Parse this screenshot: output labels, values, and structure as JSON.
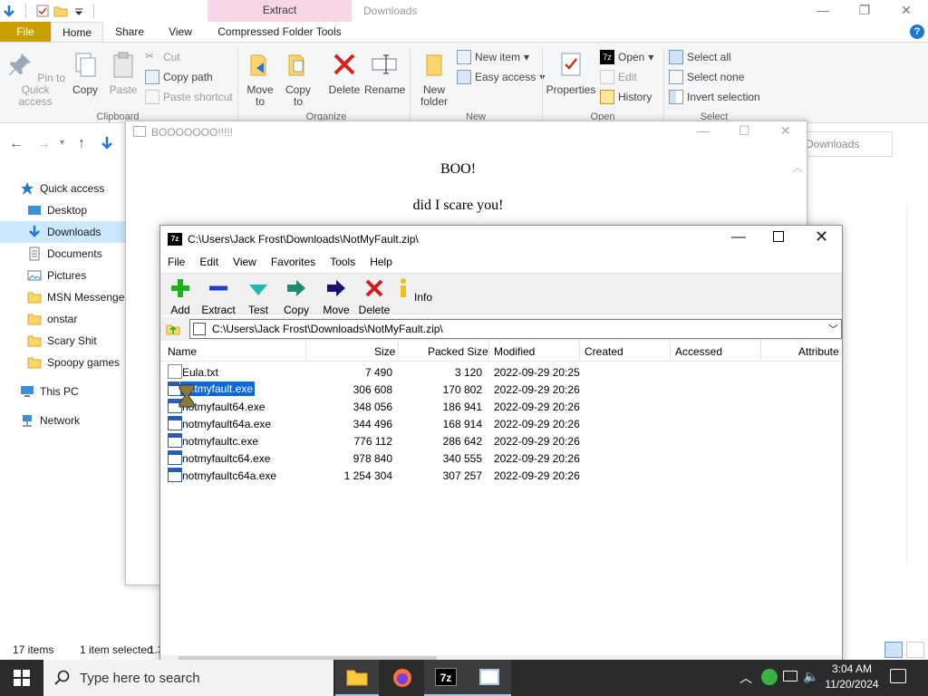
{
  "explorer": {
    "context_tab": "Extract",
    "window_title": "Downloads",
    "tabs": [
      "File",
      "Home",
      "Share",
      "View",
      "Compressed Folder Tools"
    ],
    "clipboard": {
      "pin": "Pin to Quick access",
      "copy": "Copy",
      "paste": "Paste",
      "cut": "Cut",
      "copy_path": "Copy path",
      "paste_shortcut": "Paste shortcut",
      "group": "Clipboard"
    },
    "organize": {
      "move_to": "Move to",
      "copy_to": "Copy to",
      "delete": "Delete",
      "rename": "Rename",
      "group": "Organize"
    },
    "new": {
      "new_folder": "New folder",
      "new_item": "New item",
      "easy_access": "Easy access",
      "group": "New"
    },
    "open": {
      "properties": "Properties",
      "open": "Open",
      "edit": "Edit",
      "history": "History",
      "group": "Open"
    },
    "select": {
      "select_all": "Select all",
      "select_none": "Select none",
      "invert": "Invert selection",
      "group": "Select"
    },
    "address_tail": "Downloads",
    "sidebar": [
      {
        "label": "Quick access",
        "icon": "star-icon"
      },
      {
        "label": "Desktop",
        "icon": "desktop-icon"
      },
      {
        "label": "Downloads",
        "icon": "download-icon"
      },
      {
        "label": "Documents",
        "icon": "document-icon"
      },
      {
        "label": "Pictures",
        "icon": "pictures-icon"
      },
      {
        "label": "MSN Messenger",
        "icon": "folder-icon"
      },
      {
        "label": "onstar",
        "icon": "folder-icon"
      },
      {
        "label": "Scary Shit",
        "icon": "folder-icon"
      },
      {
        "label": "Spoopy games",
        "icon": "folder-icon"
      },
      {
        "label": "This PC",
        "icon": "computer-icon"
      },
      {
        "label": "Network",
        "icon": "network-icon"
      }
    ],
    "status": {
      "items": "17 items",
      "selected": "1 item selected",
      "size_fragment": "1.3"
    }
  },
  "boo": {
    "title": "BOOOOOOO!!!!!",
    "line1": "BOO!",
    "line2": "did I scare you!"
  },
  "zip": {
    "title": "C:\\Users\\Jack Frost\\Downloads\\NotMyFault.zip\\",
    "menu": [
      "File",
      "Edit",
      "View",
      "Favorites",
      "Tools",
      "Help"
    ],
    "tools": [
      "Add",
      "Extract",
      "Test",
      "Copy",
      "Move",
      "Delete",
      "Info"
    ],
    "path": "C:\\Users\\Jack Frost\\Downloads\\NotMyFault.zip\\",
    "columns": [
      "Name",
      "Size",
      "Packed Size",
      "Modified",
      "Created",
      "Accessed",
      "Attribute"
    ],
    "rows": [
      {
        "name": "Eula.txt",
        "size": "7 490",
        "packed": "3 120",
        "modified": "2022-09-29 20:25"
      },
      {
        "name": "notmyfault.exe",
        "size": "306 608",
        "packed": "170 802",
        "modified": "2022-09-29 20:26"
      },
      {
        "name": "notmyfault64.exe",
        "size": "348 056",
        "packed": "186 941",
        "modified": "2022-09-29 20:26"
      },
      {
        "name": "notmyfault64a.exe",
        "size": "344 496",
        "packed": "168 914",
        "modified": "2022-09-29 20:26"
      },
      {
        "name": "notmyfaultc.exe",
        "size": "776 112",
        "packed": "286 642",
        "modified": "2022-09-29 20:26"
      },
      {
        "name": "notmyfaultc64.exe",
        "size": "978 840",
        "packed": "340 555",
        "modified": "2022-09-29 20:26"
      },
      {
        "name": "notmyfaultc64a.exe",
        "size": "1 254 304",
        "packed": "307 257",
        "modified": "2022-09-29 20:26"
      }
    ]
  },
  "taskbar": {
    "search_placeholder": "Type here to search",
    "time": "3:04 AM",
    "date": "11/20/2024"
  }
}
